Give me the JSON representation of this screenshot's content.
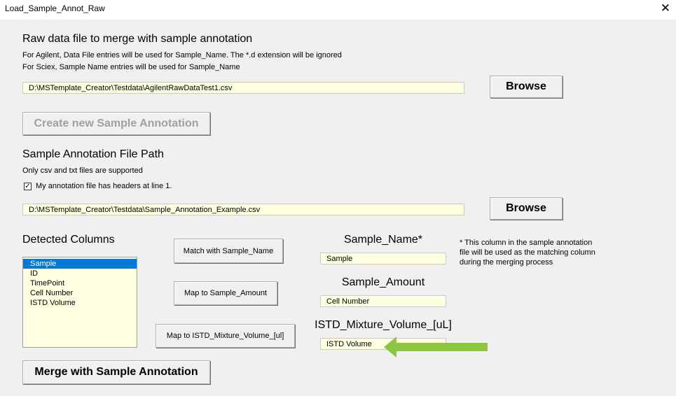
{
  "window": {
    "title": "Load_Sample_Annot_Raw",
    "close_glyph": "✕"
  },
  "raw": {
    "heading": "Raw data file to merge with sample annotation",
    "note1": "For Agilent, Data File entries will be used for Sample_Name. The *.d extension will be ignored",
    "note2": "For Sciex, Sample Name entries will be used for Sample_Name",
    "path": "D:\\MSTemplate_Creator\\Testdata\\AgilentRawDataTest1.csv",
    "browse_label": "Browse"
  },
  "create_label": "Create new Sample Annotation",
  "annot": {
    "heading": "Sample Annotation File Path",
    "note": "Only csv and txt files are supported",
    "checkbox_label": "My annotation file has headers at line 1.",
    "checkbox_checked": true,
    "path": "D:\\MSTemplate_Creator\\Testdata\\Sample_Annotation_Example.csv",
    "browse_label": "Browse"
  },
  "detected": {
    "heading": "Detected Columns",
    "items": [
      "Sample",
      "ID",
      "TimePoint",
      "Cell Number",
      "ISTD Volume"
    ],
    "selected_index": 0
  },
  "map": {
    "match_label": "Match with Sample_Name",
    "amount_label": "Map to Sample_Amount",
    "istd_label": "Map to ISTD_Mixture_Volume_[ul]"
  },
  "targets": {
    "name_heading": "Sample_Name*",
    "name_value": "Sample",
    "amount_heading": "Sample_Amount",
    "amount_value": "Cell Number",
    "istd_heading": "ISTD_Mixture_Volume_[uL]",
    "istd_value": "ISTD Volume"
  },
  "footnote": {
    "line1": "* This column in the sample annotation",
    "line2": "file will be used as the matching column",
    "line3": "during the merging process"
  },
  "merge_label": "Merge with Sample Annotation",
  "colors": {
    "field_bg": "#ffffe1",
    "selection": "#0078d7",
    "arrow": "#8dc63f"
  }
}
